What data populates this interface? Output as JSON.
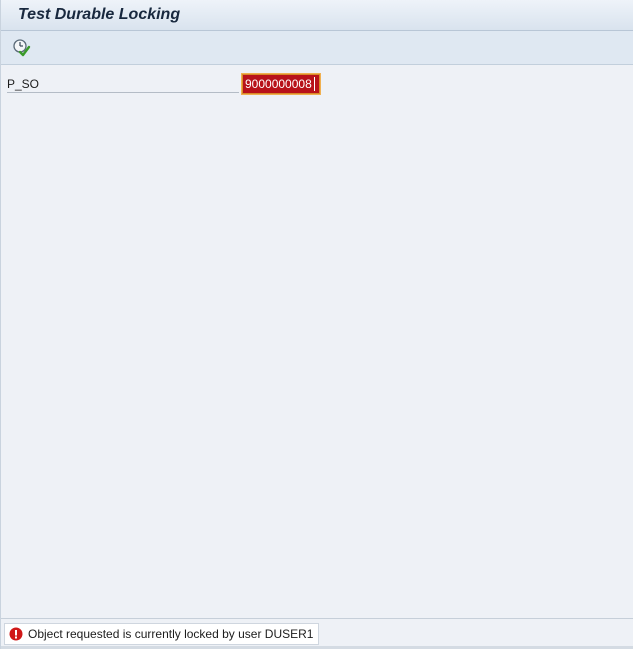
{
  "window": {
    "title": "Test Durable Locking"
  },
  "toolbar": {
    "execute_icon": "execute-icon"
  },
  "selection_screen": {
    "fields": [
      {
        "label": "P_SO",
        "value": "9000000008",
        "state": "error"
      }
    ]
  },
  "status_bar": {
    "type": "error",
    "icon": "error-icon",
    "message": "Object requested is currently locked by user DUSER1"
  },
  "colors": {
    "error_field_bg": "#b8121a",
    "error_field_border": "#f0b050",
    "error_icon": "#d01818",
    "execute_icon_green": "#3a9a2a"
  }
}
